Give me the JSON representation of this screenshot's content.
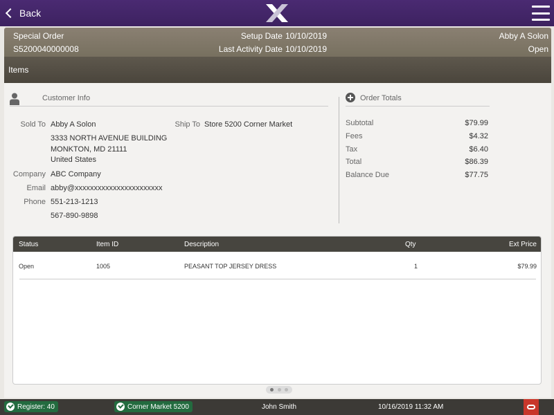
{
  "topbar": {
    "back_label": "Back"
  },
  "order": {
    "type": "Special Order",
    "number": "S5200040000008",
    "setup_date_label": "Setup Date",
    "setup_date": "10/10/2019",
    "last_activity_label": "Last Activity Date",
    "last_activity_date": "10/10/2019",
    "customer_name": "Abby A Solon",
    "status": "Open"
  },
  "section_title": "Items",
  "customer_info": {
    "title": "Customer Info",
    "sold_to_label": "Sold To",
    "sold_to_name": "Abby A Solon",
    "address_line1": "3333 NORTH AVENUE BUILDING",
    "address_line2": "MONKTON, MD 21111",
    "address_country": "United States",
    "ship_to_label": "Ship To",
    "ship_to": "Store 5200 Corner Market",
    "company_label": "Company",
    "company": "ABC Company",
    "email_label": "Email",
    "email": "abby@xxxxxxxxxxxxxxxxxxxxxxx",
    "phone_label": "Phone",
    "phone1": "551-213-1213",
    "phone2": "567-890-9898"
  },
  "order_totals": {
    "title": "Order Totals",
    "rows": [
      {
        "label": "Subtotal",
        "value": "$79.99"
      },
      {
        "label": "Fees",
        "value": "$4.32"
      },
      {
        "label": "Tax",
        "value": "$6.40"
      },
      {
        "label": "Total",
        "value": "$86.39"
      },
      {
        "label": "Balance Due",
        "value": "$77.75"
      }
    ]
  },
  "items_table": {
    "headers": {
      "status": "Status",
      "item_id": "Item ID",
      "description": "Description",
      "qty": "Qty",
      "ext_price": "Ext Price"
    },
    "rows": [
      {
        "status": "Open",
        "item_id": "1005",
        "description": "PEASANT TOP JERSEY DRESS",
        "qty": "1",
        "ext_price": "$79.99"
      }
    ]
  },
  "pager": {
    "pages": 3,
    "current": 1
  },
  "statusbar": {
    "register": "Register: 40",
    "store": "Corner Market 5200",
    "user": "John Smith",
    "datetime": "10/16/2019 11:32 AM"
  },
  "colors": {
    "topbar": "#3d2260",
    "status_ok": "#236b3f",
    "oracle": "#c8372b"
  },
  "icons": [
    "back-chevron-icon",
    "app-logo-icon",
    "hamburger-menu-icon",
    "person-icon",
    "plus-circle-icon",
    "check-circle-icon",
    "oracle-icon"
  ]
}
